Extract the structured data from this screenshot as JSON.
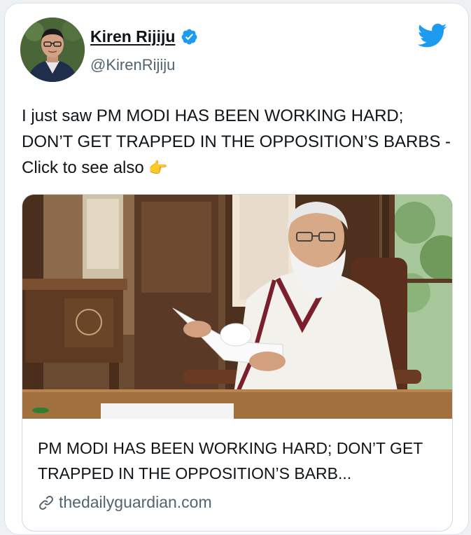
{
  "author": {
    "name": "Kiren Rijiju",
    "handle": "@KirenRijiju",
    "verified": true
  },
  "tweet": {
    "text": "I just saw PM MODI HAS BEEN WORKING HARD; DON’T GET TRAPPED IN THE OPPOSITION’S BARBS - Click to see also",
    "emoji": "👉"
  },
  "link_card": {
    "title": "PM MODI HAS BEEN WORKING HARD; DON’T GET TRAPPED IN THE OPPOSITION’S BARB...",
    "domain": "thedailyguardian.com"
  },
  "icons": {
    "brand": "twitter-bird-icon",
    "verified": "verified-badge-icon",
    "link": "link-icon"
  },
  "colors": {
    "twitter_blue": "#1d9bf0",
    "text_primary": "#0f1419",
    "text_secondary": "#536471"
  }
}
